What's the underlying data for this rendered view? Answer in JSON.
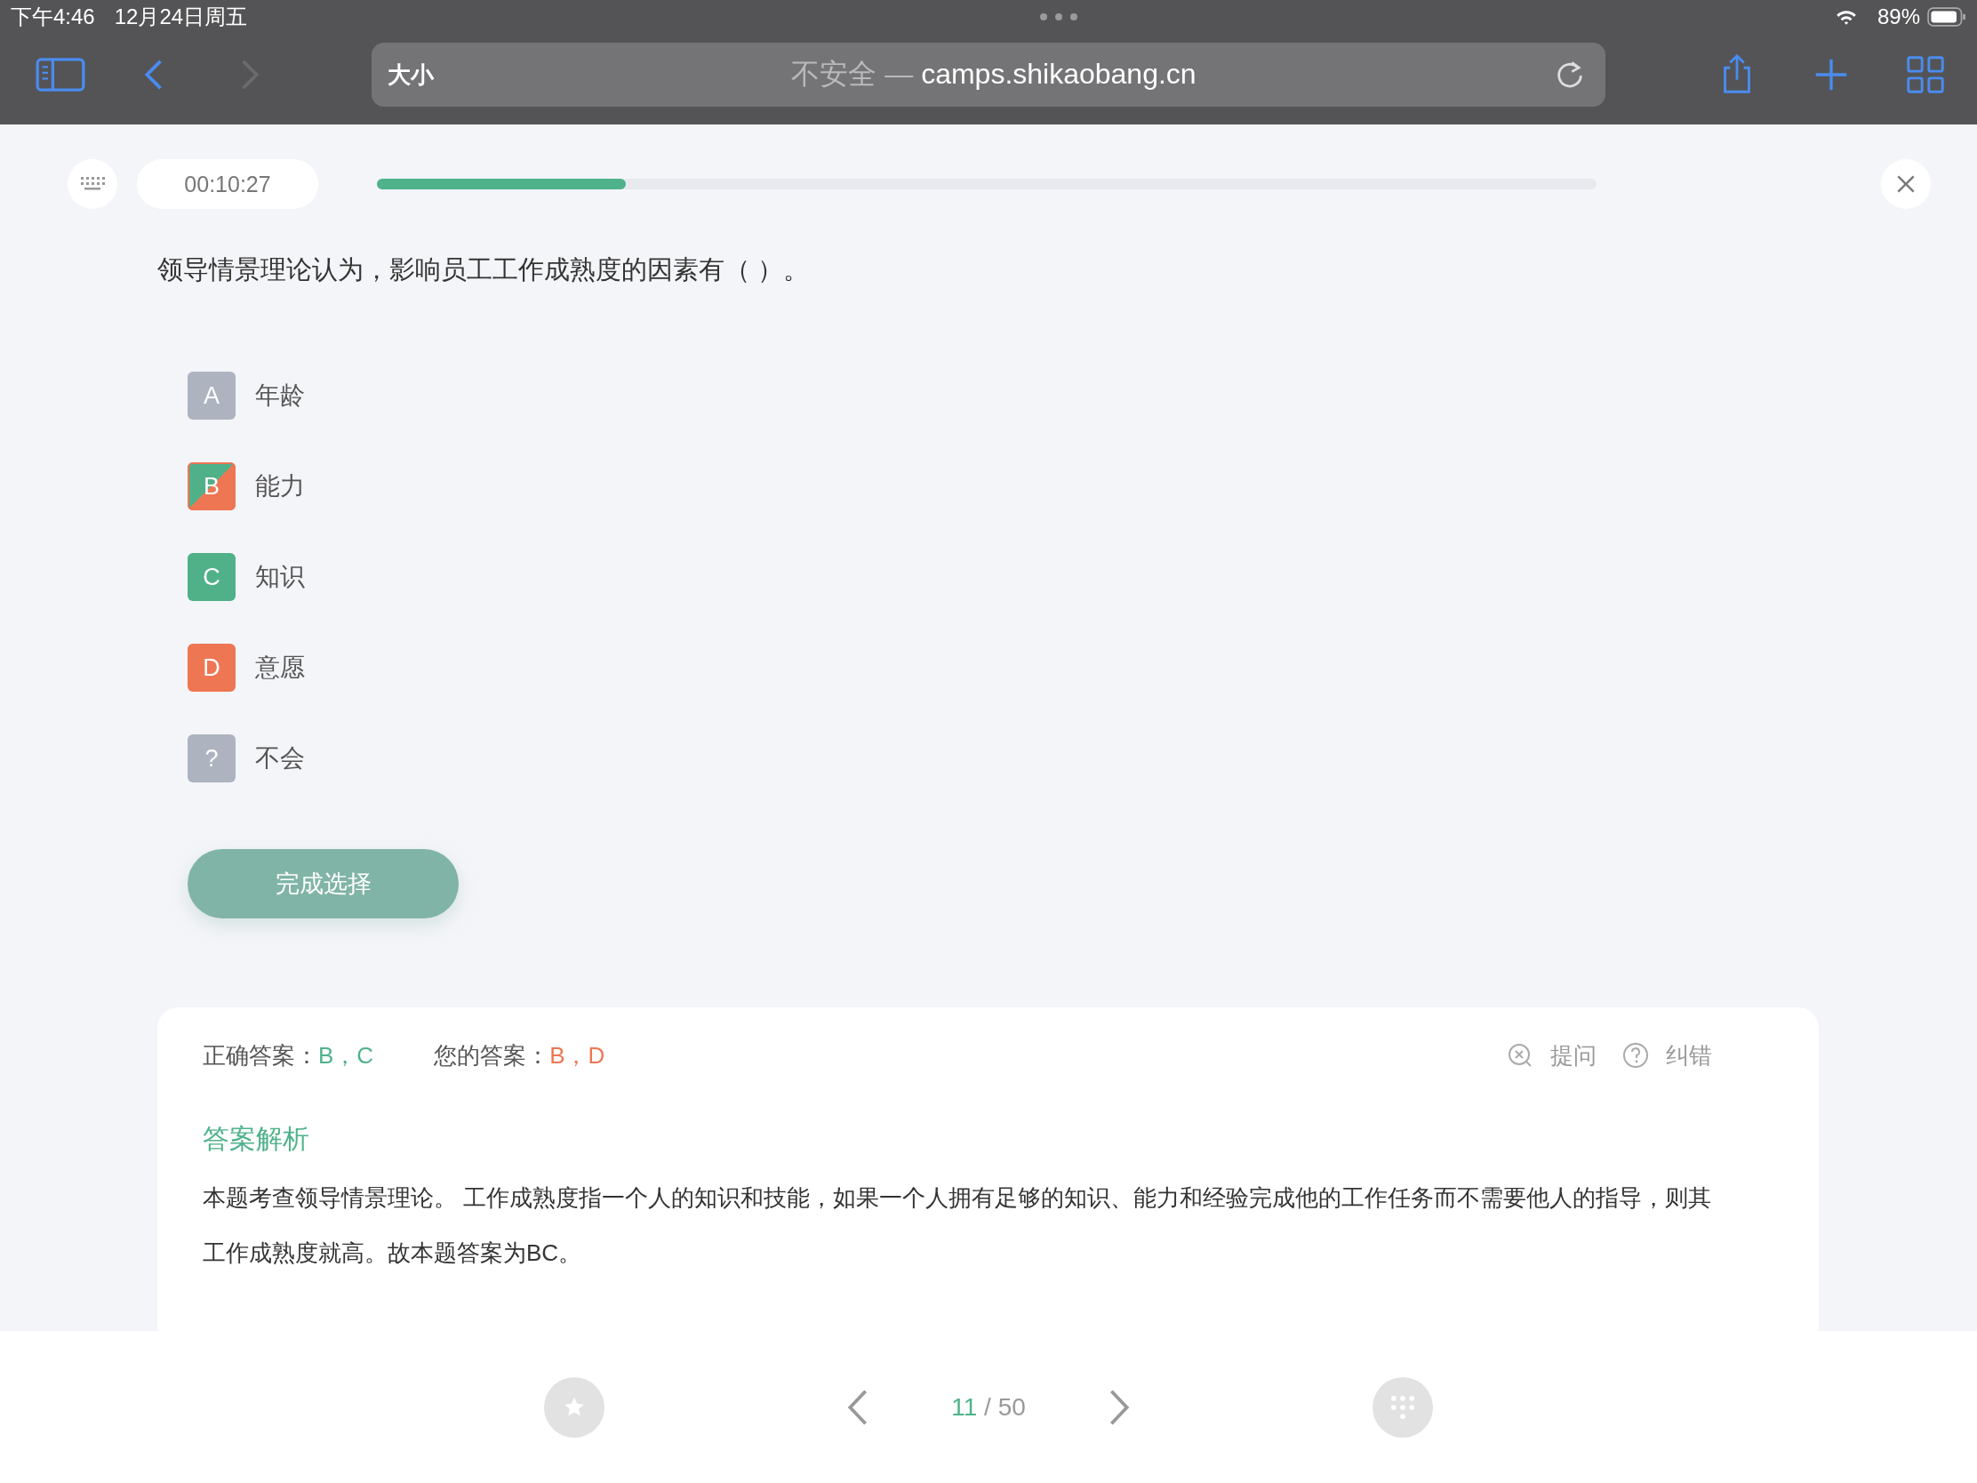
{
  "status_bar": {
    "time": "下午4:46",
    "date": "12月24日周五",
    "battery": "89%"
  },
  "browser": {
    "text_size": "大小",
    "url_prefix": "不安全 —",
    "url": "camps.shikaobang.cn"
  },
  "quiz_header": {
    "timer": "00:10:27",
    "progress": {
      "level": 0.204
    }
  },
  "question": "领导情景理论认为，影响员工工作成熟度的因素有（ ）。",
  "options": [
    {
      "letter": "A",
      "text": "年龄",
      "correct": false,
      "chosen": false
    },
    {
      "letter": "B",
      "text": "能力",
      "correct": true,
      "chosen": true
    },
    {
      "letter": "C",
      "text": "知识",
      "correct": true,
      "chosen": false
    },
    {
      "letter": "D",
      "text": "意愿",
      "correct": false,
      "chosen": true
    },
    {
      "letter": "?",
      "text": "不会",
      "correct": false,
      "chosen": false
    }
  ],
  "submit_button": "完成选择",
  "answer_panel": {
    "correct_label": "正确答案：",
    "correct_value": "B，C",
    "your_label": "您的答案：",
    "your_value": "B，D",
    "ask": "提问",
    "report": "纠错",
    "analysis_title": "答案解析",
    "analysis": "本题考查领导情景理论。 工作成熟度指一个人的知识和技能，如果一个人拥有足够的知识、能力和经验完成他的工作任务而不需要他人的指导，则其工作成熟度就高。故本题答案为BC。"
  },
  "pager": {
    "current": "11",
    "total": "/ 50"
  }
}
